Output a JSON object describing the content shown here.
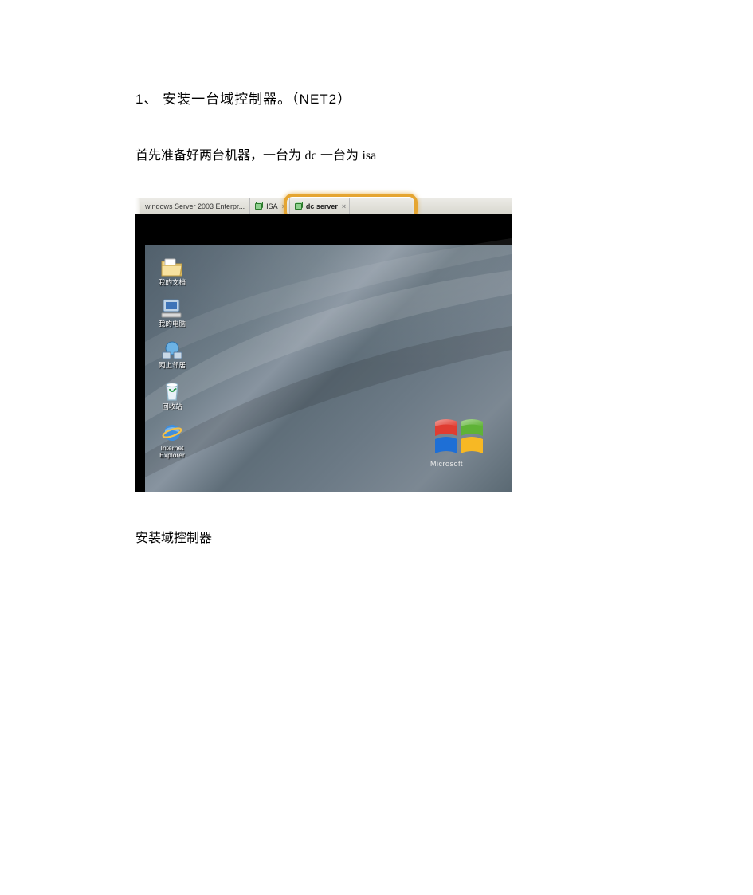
{
  "heading": "1、   安装一台域控制器。（NET2）",
  "subheading_pre": "首先准备好两台机器，一台为 ",
  "subheading_dc": "dc",
  "subheading_mid": " 一台为 ",
  "subheading_isa": "isa",
  "tabs": {
    "main": "windows Server 2003 Enterpr...",
    "vm1": "ISA",
    "vm2": "dc server"
  },
  "desktop_icons": {
    "mydocs": "我的文档",
    "mycomputer": "我的电脑",
    "network": "网上邻居",
    "recycle": "回收站",
    "ie_line1": "Internet",
    "ie_line2": "Explorer"
  },
  "winlogo_text": "Microsoft",
  "footer": "安装域控制器"
}
